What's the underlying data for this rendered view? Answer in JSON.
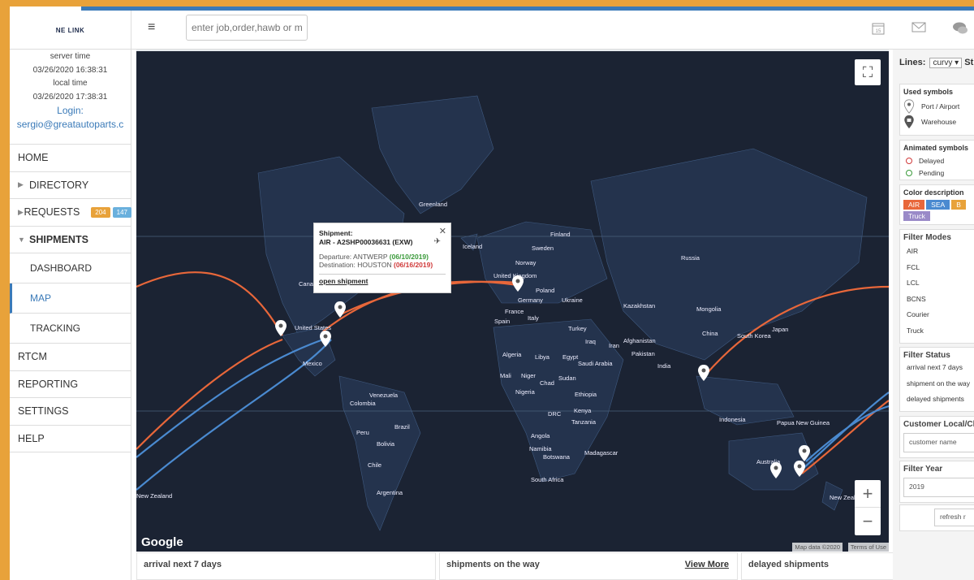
{
  "app": {
    "logo_text": "NE LINK"
  },
  "header": {
    "search_placeholder": "enter job,order,hawb or ma",
    "icons": [
      "calendar-icon",
      "mail-icon",
      "chat-icon"
    ],
    "calendar_day": "15"
  },
  "sidebar": {
    "server_time_label": "server time",
    "server_time": "03/26/2020 16:38:31",
    "local_time_label": "local time",
    "local_time": "03/26/2020 17:38:31",
    "login_label": "Login:",
    "login_user": "sergio@greatautoparts.c",
    "nav": [
      {
        "label": "HOME"
      },
      {
        "label": "DIRECTORY"
      },
      {
        "label": "REQUESTS",
        "badge1": "204",
        "badge2": "147"
      },
      {
        "label": "SHIPMENTS"
      },
      {
        "label": "DASHBOARD"
      },
      {
        "label": "MAP"
      },
      {
        "label": "TRACKING"
      },
      {
        "label": "RTCM"
      },
      {
        "label": "REPORTING"
      },
      {
        "label": "SETTINGS"
      },
      {
        "label": "HELP"
      }
    ]
  },
  "map": {
    "labels": [
      "Greenland",
      "Iceland",
      "Finland",
      "Sweden",
      "Norway",
      "United Kingdom",
      "Germany",
      "Poland",
      "France",
      "Spain",
      "Italy",
      "Ukraine",
      "Turkey",
      "Iraq",
      "Iran",
      "Russia",
      "Kazakhstan",
      "Mongolia",
      "China",
      "South Korea",
      "Japan",
      "Afghanistan",
      "Pakistan",
      "India",
      "Algeria",
      "Libya",
      "Egypt",
      "Saudi Arabia",
      "Mali",
      "Niger",
      "Chad",
      "Sudan",
      "Nigeria",
      "Ethiopia",
      "DRC",
      "Kenya",
      "Tanzania",
      "Angola",
      "Namibia",
      "Botswana",
      "South Africa",
      "Madagascar",
      "United States",
      "Mexico",
      "Canada",
      "Venezuela",
      "Colombia",
      "Brazil",
      "Peru",
      "Bolivia",
      "Chile",
      "Argentina",
      "Indonesia",
      "Papua New Guinea",
      "Australia",
      "New Zealand",
      "New Zealand"
    ],
    "google_label": "Google",
    "attribution": "Map data ©2020",
    "terms": "Terms of Use",
    "zoom_in": "+",
    "zoom_out": "−",
    "popup": {
      "heading": "Shipment:",
      "shipment": "AIR - A2SHP00036631 (EXW)",
      "departure_label": "Departure: ANTWERP",
      "departure_date": "(06/10/2019)",
      "destination_label": "Destination: HOUSTON",
      "destination_date": "(06/16/2019)",
      "link": "open shipment"
    }
  },
  "bottom": {
    "arrival": "arrival next 7 days",
    "on_the_way": "shipments on the way",
    "view_more": "View More",
    "delayed": "delayed shipments"
  },
  "right_panel": {
    "lines_label": "Lines:",
    "lines_value": "curvy ▾",
    "st_label": "St",
    "used_symbols": "Used symbols",
    "port_airport": "Port / Airport",
    "warehouse": "Warehouse",
    "animated_symbols": "Animated symbols",
    "delayed": "Delayed",
    "pending": "Pending",
    "color_description": "Color description",
    "chips": [
      {
        "label": "AIR",
        "color": "#e8673a"
      },
      {
        "label": "SEA",
        "color": "#4a8ad0"
      },
      {
        "label": "B",
        "color": "#e8a23a"
      },
      {
        "label": "Truck",
        "color": "#9a8ac8"
      }
    ],
    "filter_modes": "Filter Modes",
    "modes": [
      "AIR",
      "FCL",
      "LCL",
      "BCNS",
      "Courier",
      "Truck"
    ],
    "filter_status": "Filter Status",
    "statuses": [
      "arrival next 7 days",
      "shipment on the way",
      "delayed shipments"
    ],
    "customer_head": "Customer Local/Cl",
    "customer_placeholder": "customer name",
    "filter_year": "Filter Year",
    "year": "2019",
    "refresh": "refresh r"
  },
  "colors": {
    "air": "#e8673a",
    "sea": "#4a8ad0",
    "accent": "#3a7ab8",
    "badge_orange": "#e8a23a",
    "badge_blue": "#6ab0dd"
  }
}
